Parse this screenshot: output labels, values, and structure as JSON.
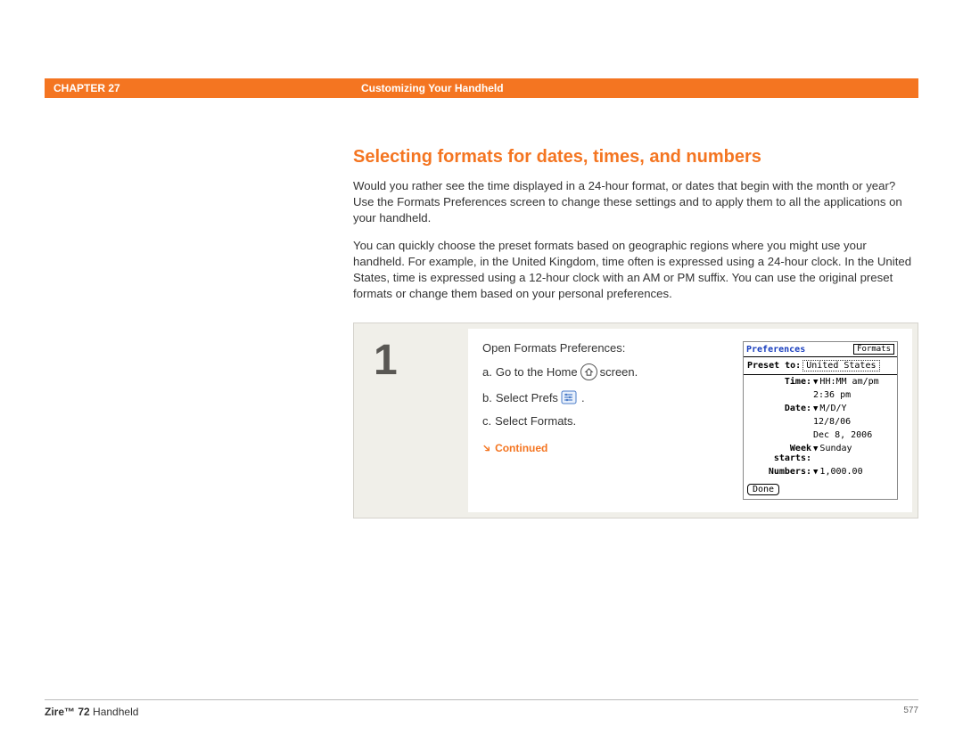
{
  "header": {
    "chapter_label": "CHAPTER 27",
    "chapter_title": "Customizing Your Handheld"
  },
  "section": {
    "title": "Selecting formats for dates, times, and numbers",
    "para1": "Would you rather see the time displayed in a 24-hour format, or dates that begin with the month or year? Use the Formats Preferences screen to change these settings and to apply them to all the applications on your handheld.",
    "para2": "You can quickly choose the preset formats based on geographic regions where you might use your handheld. For example, in the United Kingdom, time often is expressed using a 24-hour clock. In the United States, time is expressed using a 12-hour clock with an AM or PM suffix. You can use the original preset formats or change them based on your personal preferences."
  },
  "step": {
    "number": "1",
    "intro": "Open Formats Preferences:",
    "a_prefix": "a.",
    "a_before": "Go to the Home",
    "a_after": "screen.",
    "b_prefix": "b.",
    "b_text": "Select Prefs",
    "b_after": ".",
    "c_prefix": "c.",
    "c_text": "Select Formats.",
    "continued": "Continued"
  },
  "device": {
    "title": "Preferences",
    "tag": "Formats",
    "preset_label": "Preset to:",
    "preset_value": "United States",
    "rows": {
      "time_label": "Time:",
      "time_value": "HH:MM am/pm",
      "time_example": "2:36 pm",
      "date_label": "Date:",
      "date_value": "M/D/Y",
      "date_example1": "12/8/06",
      "date_example2": "Dec 8, 2006",
      "week_label": "Week starts:",
      "week_value": "Sunday",
      "numbers_label": "Numbers:",
      "numbers_value": "1,000.00"
    },
    "done": "Done"
  },
  "footer": {
    "product_bold": "Zire™ 72",
    "product_rest": " Handheld",
    "page": "577"
  }
}
